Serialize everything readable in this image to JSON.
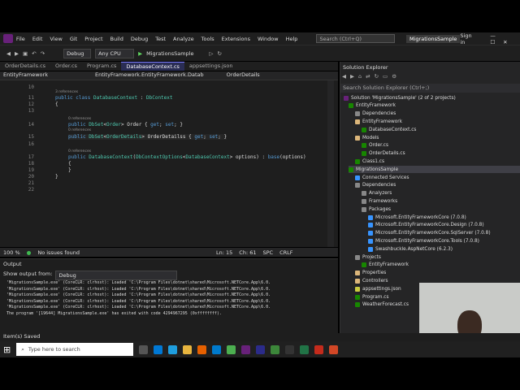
{
  "menubar": {
    "items": [
      "File",
      "Edit",
      "View",
      "Git",
      "Project",
      "Build",
      "Debug",
      "Test",
      "Analyze",
      "Tools",
      "Extensions",
      "Window",
      "Help"
    ],
    "search_placeholder": "Search (Ctrl+Q)",
    "app_title": "MigrationsSample",
    "sign_in": "Sign in"
  },
  "toolbar": {
    "config": "Debug",
    "platform": "Any CPU",
    "run_target": "MigrationsSample"
  },
  "tabs": [
    "OrderDetails.cs",
    "Order.cs",
    "Program.cs",
    "DatabaseContext.cs",
    "appsettings.json"
  ],
  "navbar": {
    "project": "EntityFramework",
    "class": "EntityFramework.EntityFramework.Datab",
    "member": "OrderDetails"
  },
  "editor": {
    "line_numbers": [
      "10",
      "11",
      "12",
      "13",
      "14",
      "15",
      "16",
      "17",
      "18",
      "19",
      "20",
      "21",
      "22"
    ],
    "refs": {
      "r11": "3 references",
      "r14": "0 references",
      "r15": "0 references",
      "r17": "0 references"
    },
    "lines": {
      "l11": "public class DatabaseContext : DbContext",
      "l12": "{",
      "l14": "public DbSet<Order> Order { get; set; }",
      "l15": "public DbSet<OrderDetails> OrderDetailss { get; set; }",
      "l17": "public DatabaseContext(DbContextOptions<DatabaseContext> options) : base(options)",
      "l18": "{",
      "l19": "}",
      "l20": "}"
    }
  },
  "status": {
    "zoom": "100 %",
    "issues": "No issues found",
    "ln": "Ln: 15",
    "ch": "Ch: 61",
    "spc": "SPC",
    "crlf": "CRLF"
  },
  "output": {
    "title": "Output",
    "show_from_label": "Show output from:",
    "show_from_value": "Debug",
    "lines": [
      "'MigrationsSample.exe' (CoreCLR: clrhost): Loaded 'C:\\Program Files\\dotnet\\shared\\Microsoft.NETCore.App\\6.0.",
      "'MigrationsSample.exe' (CoreCLR: clrhost): Loaded 'C:\\Program Files\\dotnet\\shared\\Microsoft.NETCore.App\\6.0.",
      "'MigrationsSample.exe' (CoreCLR: clrhost): Loaded 'C:\\Program Files\\dotnet\\shared\\Microsoft.NETCore.App\\6.0.",
      "'MigrationsSample.exe' (CoreCLR: clrhost): Loaded 'C:\\Program Files\\dotnet\\shared\\Microsoft.NETCore.App\\6.0.",
      "'MigrationsSample.exe' (CoreCLR: clrhost): Loaded 'C:\\Program Files\\dotnet\\shared\\Microsoft.NETCore.App\\6.0.",
      "The program '[19644] MigrationsSample.exe' has exited with code 4294967295 (0xffffffff)."
    ]
  },
  "solution_explorer": {
    "title": "Solution Explorer",
    "search": "Search Solution Explorer (Ctrl+;)",
    "items": [
      {
        "label": "Solution 'MigrationsSample' (2 of 2 projects)",
        "color": "#68217a"
      },
      {
        "label": "EntityFramework",
        "color": "#178600"
      },
      {
        "label": "Dependencies",
        "color": "#888888"
      },
      {
        "label": "EntityFramework",
        "color": "#dcb67a"
      },
      {
        "label": "DatabaseContext.cs",
        "color": "#178600"
      },
      {
        "label": "Models",
        "color": "#dcb67a"
      },
      {
        "label": "Order.cs",
        "color": "#178600"
      },
      {
        "label": "OrderDetails.cs",
        "color": "#178600"
      },
      {
        "label": "Class1.cs",
        "color": "#178600"
      },
      {
        "label": "MigrationsSample",
        "color": "#178600"
      },
      {
        "label": "Connected Services",
        "color": "#3794ff"
      },
      {
        "label": "Dependencies",
        "color": "#888888"
      },
      {
        "label": "Analyzers",
        "color": "#888888"
      },
      {
        "label": "Frameworks",
        "color": "#888888"
      },
      {
        "label": "Packages",
        "color": "#888888"
      },
      {
        "label": "Microsoft.EntityFrameworkCore (7.0.8)",
        "color": "#3794ff"
      },
      {
        "label": "Microsoft.EntityFrameworkCore.Design (7.0.8)",
        "color": "#3794ff"
      },
      {
        "label": "Microsoft.EntityFrameworkCore.SqlServer (7.0.8)",
        "color": "#3794ff"
      },
      {
        "label": "Microsoft.EntityFrameworkCore.Tools (7.0.8)",
        "color": "#3794ff"
      },
      {
        "label": "Swashbuckle.AspNetCore (6.2.3)",
        "color": "#3794ff"
      },
      {
        "label": "Projects",
        "color": "#888888"
      },
      {
        "label": "EntityFramework",
        "color": "#178600"
      },
      {
        "label": "Properties",
        "color": "#dcb67a"
      },
      {
        "label": "Controllers",
        "color": "#dcb67a"
      },
      {
        "label": "appsettings.json",
        "color": "#cbcb41"
      },
      {
        "label": "Program.cs",
        "color": "#178600"
      },
      {
        "label": "WeatherForecast.cs",
        "color": "#178600"
      }
    ]
  },
  "statusline": "Item(s) Saved",
  "taskbar": {
    "search_placeholder": "Type here to search"
  }
}
